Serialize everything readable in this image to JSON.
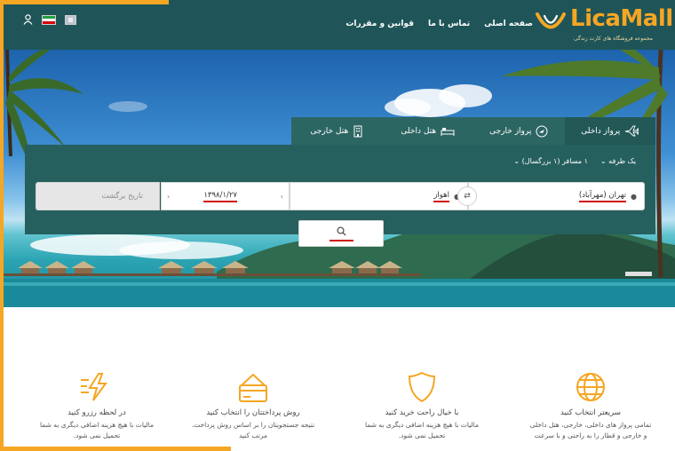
{
  "header": {
    "logo_text": "LicaMall",
    "logo_tagline": "مجموعه فروشگاه های کارت زندگی",
    "nav": [
      "صفحه اصلی",
      "تماس با ما",
      "قوانین و مقررات"
    ],
    "icons": [
      "user-icon",
      "iran-flag-icon",
      "uk-flag-icon"
    ]
  },
  "search": {
    "tabs": [
      {
        "label": "پرواز داخلی",
        "icon": "airplane-icon",
        "active": true
      },
      {
        "label": "پرواز خارجی",
        "icon": "globe-plane-icon",
        "active": false
      },
      {
        "label": "هتل داخلی",
        "icon": "bed-icon",
        "active": false
      },
      {
        "label": "هتل خارجی",
        "icon": "hotel-building-icon",
        "active": false
      }
    ],
    "trip_type": "یک طرفه",
    "passengers": "۱ مسافر (۱ بزرگسال)",
    "origin": "تهران (مهرآباد)",
    "destination": "اهواز",
    "departure_date": "۱۳۹۸/۱/۲۷",
    "return_placeholder": "تاریخ برگشت"
  },
  "features": [
    {
      "title": "سریعتر انتخاب کنید",
      "desc_lines": [
        "تمامی پرواز های داخلی، خارجی، هتل داخلی",
        "و خارجی و قطار را به راحتی و با سرعت"
      ],
      "icon": "globe-icon"
    },
    {
      "title": "با خیال راحت خرید کنید",
      "desc_lines": [
        "مالیات با هیچ هزینه اضافی دیگری به شما",
        "تحمیل نمی شود."
      ],
      "icon": "shield-icon"
    },
    {
      "title": "روش پرداختتان را انتخاب کنید",
      "desc_lines": [
        "نتیجه جستجویتان را بر اساس روش پرداخت.",
        "مرتب کنید"
      ],
      "icon": "credit-card-icon"
    },
    {
      "title": "در لحظه رزرو کنید",
      "desc_lines": [
        "مالیات با هیچ هزینه اضافی دیگری به شما",
        "تحمیل نمی شود."
      ],
      "icon": "lightning-icon"
    }
  ],
  "colors": {
    "header_bg": "#1f5558",
    "accent": "#f5a623",
    "panel_bg": "#26605e",
    "underline": "#d01010"
  }
}
